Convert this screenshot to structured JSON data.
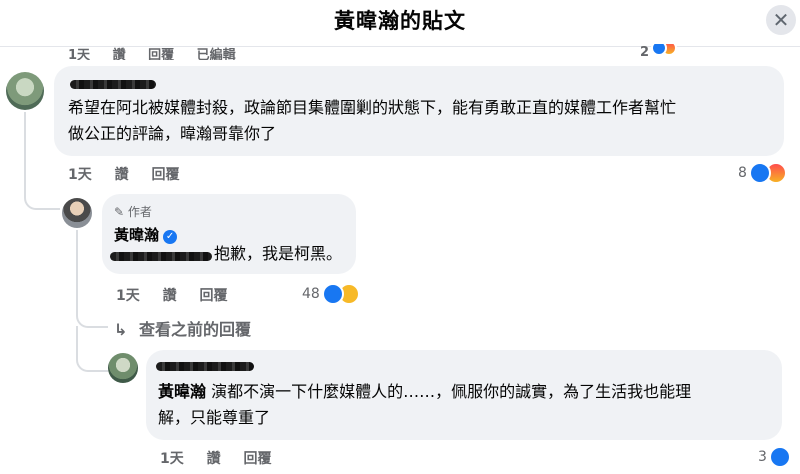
{
  "header": {
    "title": "黃暐瀚的貼文",
    "close_icon": "close-icon"
  },
  "top_cut": {
    "items": [
      "1天",
      "讚",
      "回覆",
      "已編輯"
    ],
    "count": "2"
  },
  "comment1": {
    "text_line1": "希望在阿北被媒體封殺，政論節目集體圍剿的狀態下，能有勇敢正直的媒體工作者幫忙",
    "text_line2": "做公正的評論，暐瀚哥靠你了",
    "time": "1天",
    "like_label": "讚",
    "reply_label": "回覆",
    "reaction_count": "8"
  },
  "reply1": {
    "author_tag": "作者",
    "author_name": "黃暐瀚",
    "text": "抱歉，我是柯黑。",
    "time": "1天",
    "like_label": "讚",
    "reply_label": "回覆",
    "reaction_count": "48"
  },
  "view_previous": {
    "label": "查看之前的回覆",
    "icon": "reply-arrow-icon"
  },
  "reply2": {
    "mention": "黃暐瀚",
    "text_line1": " 演都不演一下什麼媒體人的……，佩服你的誠實，為了生活我也能理",
    "text_line2": "解，只能尊重了",
    "time": "1天",
    "like_label": "讚",
    "reply_label": "回覆",
    "reaction_count": "3"
  },
  "colors": {
    "like_blue": "#1877f2",
    "bubble": "#f0f2f5",
    "meta": "#65676b"
  }
}
